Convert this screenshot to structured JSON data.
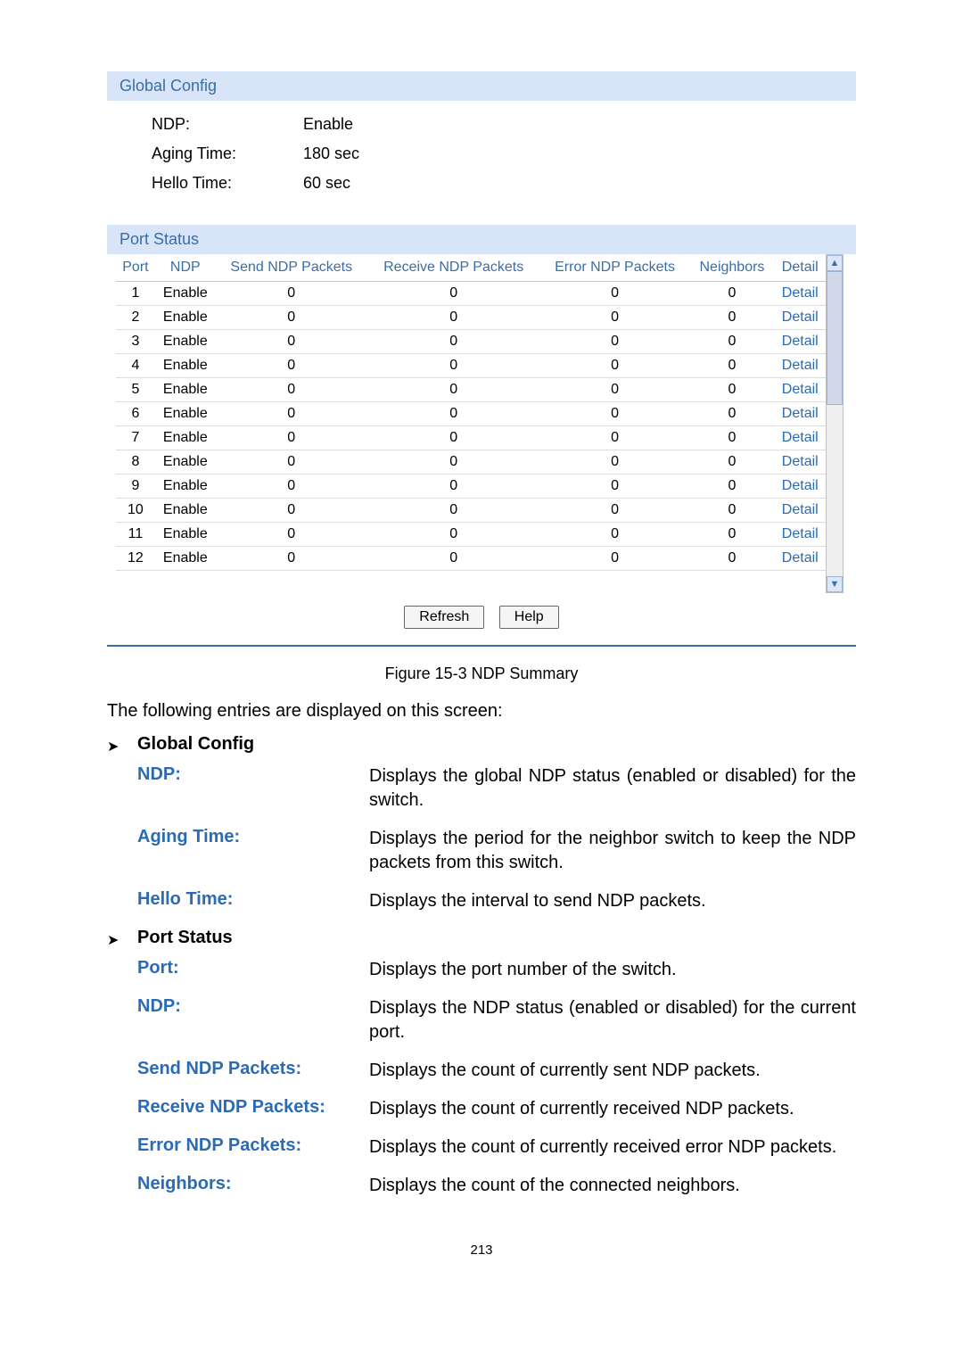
{
  "globalConfig": {
    "sectionTitle": "Global Config",
    "rows": [
      {
        "label": "NDP:",
        "value": "Enable"
      },
      {
        "label": "Aging Time:",
        "value": "180 sec"
      },
      {
        "label": "Hello Time:",
        "value": "60 sec"
      }
    ]
  },
  "portStatusSection": {
    "sectionTitle": "Port Status",
    "headers": [
      "Port",
      "NDP",
      "Send NDP Packets",
      "Receive NDP Packets",
      "Error NDP Packets",
      "Neighbors",
      "Detail"
    ],
    "rows": [
      {
        "port": "1",
        "ndp": "Enable",
        "send": "0",
        "recv": "0",
        "err": "0",
        "nbr": "0",
        "detail": "Detail"
      },
      {
        "port": "2",
        "ndp": "Enable",
        "send": "0",
        "recv": "0",
        "err": "0",
        "nbr": "0",
        "detail": "Detail"
      },
      {
        "port": "3",
        "ndp": "Enable",
        "send": "0",
        "recv": "0",
        "err": "0",
        "nbr": "0",
        "detail": "Detail"
      },
      {
        "port": "4",
        "ndp": "Enable",
        "send": "0",
        "recv": "0",
        "err": "0",
        "nbr": "0",
        "detail": "Detail"
      },
      {
        "port": "5",
        "ndp": "Enable",
        "send": "0",
        "recv": "0",
        "err": "0",
        "nbr": "0",
        "detail": "Detail"
      },
      {
        "port": "6",
        "ndp": "Enable",
        "send": "0",
        "recv": "0",
        "err": "0",
        "nbr": "0",
        "detail": "Detail"
      },
      {
        "port": "7",
        "ndp": "Enable",
        "send": "0",
        "recv": "0",
        "err": "0",
        "nbr": "0",
        "detail": "Detail"
      },
      {
        "port": "8",
        "ndp": "Enable",
        "send": "0",
        "recv": "0",
        "err": "0",
        "nbr": "0",
        "detail": "Detail"
      },
      {
        "port": "9",
        "ndp": "Enable",
        "send": "0",
        "recv": "0",
        "err": "0",
        "nbr": "0",
        "detail": "Detail"
      },
      {
        "port": "10",
        "ndp": "Enable",
        "send": "0",
        "recv": "0",
        "err": "0",
        "nbr": "0",
        "detail": "Detail"
      },
      {
        "port": "11",
        "ndp": "Enable",
        "send": "0",
        "recv": "0",
        "err": "0",
        "nbr": "0",
        "detail": "Detail"
      },
      {
        "port": "12",
        "ndp": "Enable",
        "send": "0",
        "recv": "0",
        "err": "0",
        "nbr": "0",
        "detail": "Detail"
      }
    ],
    "buttons": {
      "refresh": "Refresh",
      "help": "Help"
    }
  },
  "figCaption": "Figure 15-3 NDP Summary",
  "introText": "The following entries are displayed on this screen:",
  "defs": [
    {
      "header": "Global Config",
      "items": [
        {
          "term": "NDP:",
          "desc": "Displays the global NDP status (enabled or disabled) for the switch."
        },
        {
          "term": "Aging Time:",
          "desc": "Displays the period for the neighbor switch to keep the NDP packets from this switch."
        },
        {
          "term": "Hello Time:",
          "desc": "Displays the interval to send NDP packets."
        }
      ]
    },
    {
      "header": "Port Status",
      "items": [
        {
          "term": "Port:",
          "desc": "Displays the port number of the switch."
        },
        {
          "term": "NDP:",
          "desc": "Displays the NDP status (enabled or disabled) for the current port."
        },
        {
          "term": "Send NDP Packets:",
          "desc": "Displays the count of currently sent NDP packets."
        },
        {
          "term": "Receive NDP Packets:",
          "desc": "Displays the count of currently received NDP packets."
        },
        {
          "term": "Error NDP Packets:",
          "desc": "Displays the count of currently received error NDP packets."
        },
        {
          "term": "Neighbors:",
          "desc": "Displays the count of the connected neighbors."
        }
      ]
    }
  ],
  "pageNumber": "213"
}
